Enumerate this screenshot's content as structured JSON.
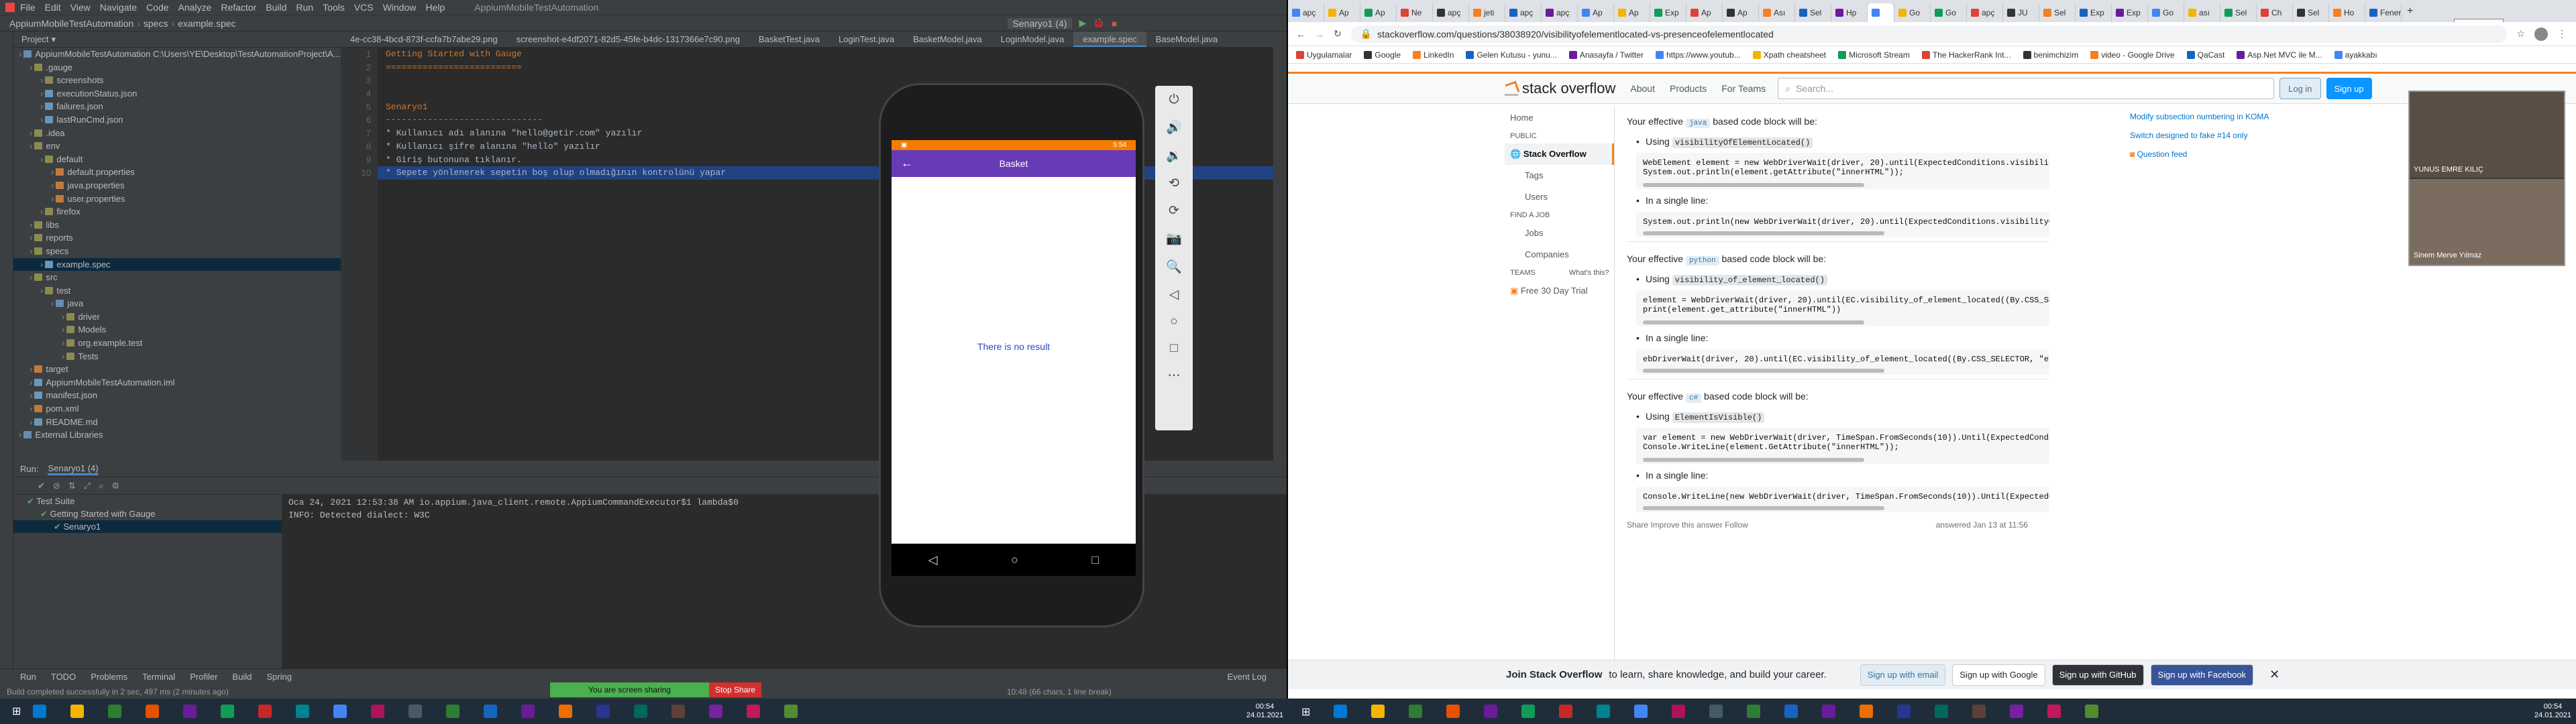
{
  "ide": {
    "menu": [
      "File",
      "Edit",
      "View",
      "Navigate",
      "Code",
      "Analyze",
      "Refactor",
      "Build",
      "Run",
      "Tools",
      "VCS",
      "Window",
      "Help"
    ],
    "window_title": "AppiumMobileTestAutomation",
    "breadcrumb": [
      "AppiumMobileTestAutomation",
      "specs",
      "example.spec"
    ],
    "run_config": "Senaryo1 (4)",
    "project_label": "Project",
    "tree": [
      {
        "label": "AppiumMobileTestAutomation C:\\Users\\YE\\Desktop\\TestAutomationProject\\A...",
        "icon": "fb",
        "indent": 0,
        "sel": false
      },
      {
        "label": ".gauge",
        "icon": "fo",
        "indent": 1,
        "sel": false
      },
      {
        "label": "screenshots",
        "icon": "fo",
        "indent": 2,
        "sel": false
      },
      {
        "label": "executionStatus.json",
        "icon": "fj",
        "indent": 2,
        "sel": false
      },
      {
        "label": "failures.json",
        "icon": "fj",
        "indent": 2,
        "sel": false
      },
      {
        "label": "lastRunCmd.json",
        "icon": "fj",
        "indent": 2,
        "sel": false
      },
      {
        "label": ".idea",
        "icon": "fo",
        "indent": 1,
        "sel": false
      },
      {
        "label": "env",
        "icon": "fo",
        "indent": 1,
        "sel": false
      },
      {
        "label": "default",
        "icon": "fo",
        "indent": 2,
        "sel": false
      },
      {
        "label": "default.properties",
        "icon": "fr",
        "indent": 3,
        "sel": false
      },
      {
        "label": "java.properties",
        "icon": "fr",
        "indent": 3,
        "sel": false
      },
      {
        "label": "user.properties",
        "icon": "fr",
        "indent": 3,
        "sel": false
      },
      {
        "label": "firefox",
        "icon": "fo",
        "indent": 2,
        "sel": false
      },
      {
        "label": "libs",
        "icon": "fo",
        "indent": 1,
        "sel": false
      },
      {
        "label": "reports",
        "icon": "fo",
        "indent": 1,
        "sel": false
      },
      {
        "label": "specs",
        "icon": "fo",
        "indent": 1,
        "sel": false
      },
      {
        "label": "example.spec",
        "icon": "fj",
        "indent": 2,
        "sel": true
      },
      {
        "label": "src",
        "icon": "fo",
        "indent": 1,
        "sel": false
      },
      {
        "label": "test",
        "icon": "fo",
        "indent": 2,
        "sel": false
      },
      {
        "label": "java",
        "icon": "fb",
        "indent": 3,
        "sel": false
      },
      {
        "label": "driver",
        "icon": "fo",
        "indent": 4,
        "sel": false
      },
      {
        "label": "Models",
        "icon": "fo",
        "indent": 4,
        "sel": false
      },
      {
        "label": "org.example.test",
        "icon": "fo",
        "indent": 4,
        "sel": false
      },
      {
        "label": "Tests",
        "icon": "fo",
        "indent": 4,
        "sel": false
      },
      {
        "label": "target",
        "icon": "fr",
        "indent": 1,
        "sel": false
      },
      {
        "label": "AppiumMobileTestAutomation.iml",
        "icon": "fj",
        "indent": 1,
        "sel": false
      },
      {
        "label": "manifest.json",
        "icon": "fj",
        "indent": 1,
        "sel": false
      },
      {
        "label": "pom.xml",
        "icon": "fr",
        "indent": 1,
        "sel": false
      },
      {
        "label": "README.md",
        "icon": "fj",
        "indent": 1,
        "sel": false
      },
      {
        "label": "External Libraries",
        "icon": "fb",
        "indent": 0,
        "sel": false
      }
    ],
    "tabs": [
      "4e-cc38-4bcd-873f-ccfa7b7abe29.png",
      "screenshot-e4df2071-82d5-45fe-b4dc-1317366e7c90.png",
      "BasketTest.java",
      "LoginTest.java",
      "BasketModel.java",
      "LoginModel.java",
      "example.spec",
      "BaseModel.java"
    ],
    "active_tab": 6,
    "code_lines": [
      {
        "n": "1",
        "text": "Getting Started with Gauge",
        "cls": "c-h1",
        "hl": false
      },
      {
        "n": "2",
        "text": "==========================",
        "cls": "c-h1",
        "hl": false
      },
      {
        "n": "3",
        "text": "",
        "cls": "c-item",
        "hl": false
      },
      {
        "n": "4",
        "text": "",
        "cls": "c-item",
        "hl": false
      },
      {
        "n": "5",
        "text": "Senaryo1",
        "cls": "c-h2",
        "hl": false
      },
      {
        "n": "6",
        "text": "------------------------------",
        "cls": "c-h2",
        "hl": false
      },
      {
        "n": "7",
        "text": "* Kullanıcı adı alanına \"hello@getir.com\" yazılır",
        "cls": "c-item",
        "hl": false
      },
      {
        "n": "8",
        "text": "* Kullanıcı şifre alanına \"hello\" yazılır",
        "cls": "c-item",
        "hl": false
      },
      {
        "n": "9",
        "text": "* Giriş butonuna tıklanır.",
        "cls": "c-item",
        "hl": false
      },
      {
        "n": "10",
        "text": "* Sepete yönlenerek sepetin boş olup olmadığının kontrolünü yapar",
        "cls": "c-item",
        "hl": true
      }
    ],
    "run_label": "Run:",
    "run_tab": "Senaryo1 (4)",
    "run_tree": [
      "Test Suite",
      "Getting Started with Gauge",
      "Senaryo1"
    ],
    "console": [
      "Oca 24, 2021 12:53:38 AM io.appium.java_client.remote.AppiumCommandExecutor$1 lambda$0",
      "INFO: Detected dialect: W3C"
    ],
    "bottom_tabs": [
      "Run",
      "TODO",
      "Problems",
      "Terminal",
      "Profiler",
      "Build",
      "Spring"
    ],
    "event_log": "Event Log",
    "status": "Build completed successfully in 2 sec, 497 ms (2 minutes ago)",
    "status_right": "10:48 (66 chars, 1 line break)",
    "share_text": "You are screen sharing",
    "stop_share": "Stop Share"
  },
  "phone": {
    "time": "5:54",
    "title": "Basket",
    "empty": "There is no result"
  },
  "chrome": {
    "tabs": [
      "apç",
      "Ap",
      "Ap",
      "Ne",
      "apç",
      "jeti",
      "apç",
      "apç",
      "Ap",
      "Ap",
      "Exp",
      "Ap",
      "Ap",
      "Ası",
      "Sel",
      "Hp",
      "",
      "Go",
      "Go",
      "apç",
      "JU",
      "Sel",
      "Exp",
      "Exp",
      "Go",
      "ası",
      "Sel",
      "Ch",
      "Sel",
      "Ho",
      "Fenerb"
    ],
    "active_tab": 16,
    "tooltip": "Yeni sekme",
    "url": "stackoverflow.com/questions/38038920/visibilityofelementlocated-vs-presenceofelementlocated",
    "bookmarks": [
      "Uygulamalar",
      "Google",
      "LinkedIn",
      "Gelen Kutusu - yunu...",
      "Anasayfa / Twitter",
      "https://www.youtub...",
      "Xpath cheatsheet",
      "Microsoft Stream",
      "The HackerRank Int...",
      "benimchizim",
      "video - Google Drive",
      "QaCast",
      "Asp.Net MVC ile M...",
      "ayakkabı"
    ]
  },
  "so": {
    "logo": "stack overflow",
    "nav": [
      "About",
      "Products",
      "For Teams"
    ],
    "search_placeholder": "Search...",
    "login": "Log in",
    "signup": "Sign up",
    "left": {
      "home": "Home",
      "public": "PUBLIC",
      "so": "Stack Overflow",
      "tags": "Tags",
      "users": "Users",
      "find_job": "FIND A JOB",
      "jobs": "Jobs",
      "companies": "Companies",
      "teams": "TEAMS",
      "whats_this": "What's this?",
      "trial": "Free 30 Day Trial"
    },
    "side": [
      "Modify subsection numbering in KOMA",
      "Switch designed to fake #14 only",
      "Question feed"
    ],
    "sections": [
      {
        "lead": "Your effective",
        "tag": "java",
        "tail": "based code block will be:",
        "using": "visibilityOfElementLocated()",
        "code": "WebElement element = new WebDriverWait(driver, 20).until(ExpectedConditions.visibility\nSystem.out.println(element.getAttribute(\"innerHTML\"));",
        "single": "In a single line:",
        "code2": "System.out.println(new WebDriverWait(driver, 20).until(ExpectedConditions.visibilityOf"
      },
      {
        "lead": "Your effective",
        "tag": "python",
        "tail": "based code block will be:",
        "using": "visibility_of_element_located()",
        "code": "element = WebDriverWait(driver, 20).until(EC.visibility_of_element_located((By.CSS_SELE\nprint(element.get_attribute(\"innerHTML\"))",
        "single": "In a single line:",
        "code2": "ebDriverWait(driver, 20).until(EC.visibility_of_element_located((By.CSS_SELECTOR, \"eleme"
      },
      {
        "lead": "Your effective",
        "tag": "c#",
        "tail": "based code block will be:",
        "using": "ElementIsVisible()",
        "code": "var element = new WebDriverWait(driver, TimeSpan.FromSeconds(10)).Until(ExpectedCondit\nConsole.WriteLine(element.GetAttribute(\"innerHTML\"));",
        "single": "In a single line:",
        "code2": "Console.WriteLine(new WebDriverWait(driver, TimeSpan.FromSeconds(10)).Until(ExpectedCon"
      }
    ],
    "share": "Share  Improve this answer  Follow",
    "answered": "answered Jan 13 at 11:56",
    "footer_lead": "Join Stack Overflow",
    "footer_text": "to learn, share knowledge, and build your career.",
    "btn_email": "Sign up with email",
    "btn_google": "Sign up with Google",
    "btn_github": "Sign up with GitHub",
    "btn_facebook": "Sign up with Facebook",
    "cam_names": [
      "YUNUS EMRE KILIÇ",
      "Sinem Merve Yılmaz"
    ]
  },
  "taskbar": {
    "left_time": "00:54",
    "left_date": "24.01.2021",
    "right_time": "00:54",
    "right_date": "24.01.2021"
  }
}
